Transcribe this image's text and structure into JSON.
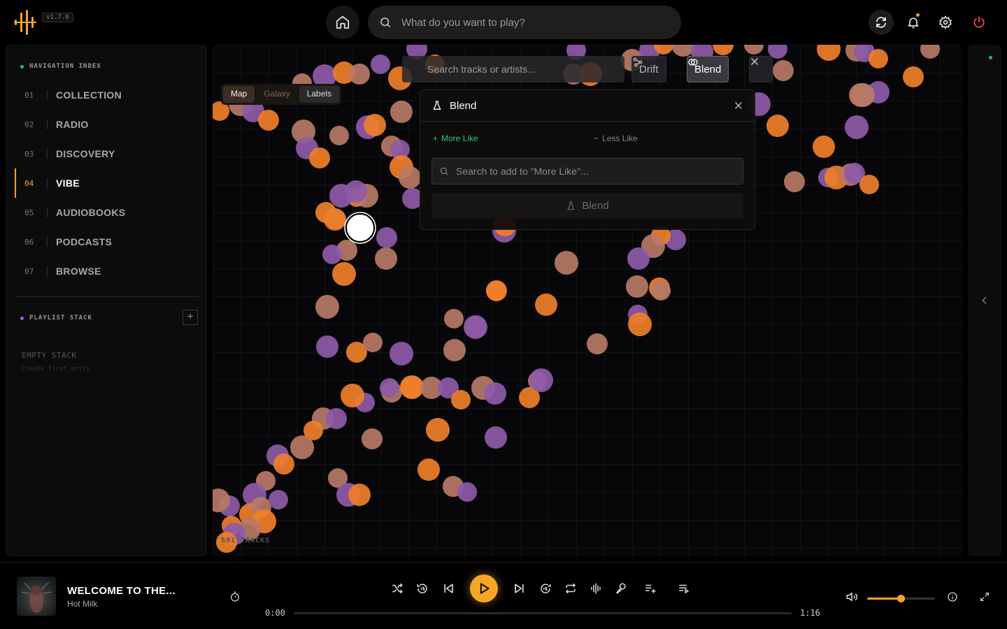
{
  "app": {
    "version": "v1.7.0",
    "search_placeholder": "What do you want to play?",
    "logo_icon": "waveform-logo-icon",
    "accent_color": "#f5a623"
  },
  "topbar": {
    "icons": [
      "home-icon",
      "search-icon",
      "refresh-icon",
      "bell-icon",
      "gear-icon",
      "power-icon"
    ]
  },
  "sidebar": {
    "nav_title": "NAVIGATION INDEX",
    "items": [
      {
        "num": "01",
        "label": "COLLECTION"
      },
      {
        "num": "02",
        "label": "RADIO"
      },
      {
        "num": "03",
        "label": "DISCOVERY"
      },
      {
        "num": "04",
        "label": "VIBE"
      },
      {
        "num": "05",
        "label": "AUDIOBOOKS"
      },
      {
        "num": "06",
        "label": "PODCASTS"
      },
      {
        "num": "07",
        "label": "BROWSE"
      }
    ],
    "active_index": 3,
    "playlist_title": "PLAYLIST STACK",
    "add_label": "+",
    "empty_title": "EMPTY STACK",
    "empty_sub": "Create first entry"
  },
  "map": {
    "tabs": [
      "Map",
      "Galaxy",
      "Labels"
    ],
    "active_tab": "Map",
    "search_placeholder": "Search tracks or artists...",
    "drift_label": "Drift",
    "blend_label": "Blend",
    "track_count": "591 TRACKS"
  },
  "blend_panel": {
    "title": "Blend",
    "more_like": "More Like",
    "less_like": "Less Like",
    "search_placeholder": "Search to add to \"More Like\"...",
    "submit_label": "Blend"
  },
  "player": {
    "track_title": "WELCOME TO THE...",
    "artist": "Hot Milk",
    "time_current": "0:00",
    "time_total": "1:16",
    "progress": 0,
    "volume": 0.5,
    "controls": [
      "shuffle-icon",
      "rewind-15-icon",
      "previous-icon",
      "play-icon",
      "next-icon",
      "forward-15-icon",
      "repeat-icon",
      "waveform-icon",
      "mic-icon",
      "queue-add-icon",
      "queue-icon"
    ]
  }
}
